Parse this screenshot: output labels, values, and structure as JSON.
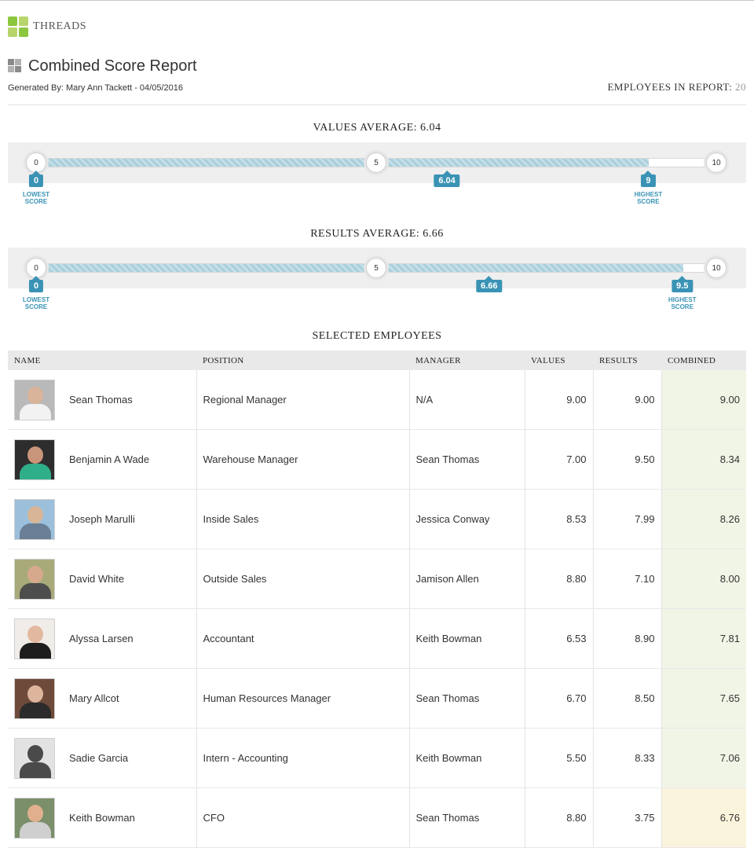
{
  "brand": "THREADS",
  "report": {
    "title": "Combined Score Report",
    "generated": "Generated By: Mary Ann Tackett - 04/05/2016",
    "employees_label": "EMPLOYEES IN REPORT:",
    "employees_count": "20"
  },
  "scales": [
    {
      "title": "VALUES AVERAGE: 6.04",
      "min_label": "0",
      "mid_label": "5",
      "max_label": "10",
      "min": 0,
      "max": 10,
      "lowest": 0,
      "lowest_label": "0",
      "highest": 9,
      "highest_label": "9",
      "average": 6.04,
      "average_label": "6.04",
      "lowest_caption": "LOWEST SCORE",
      "highest_caption": "HIGHEST SCORE"
    },
    {
      "title": "RESULTS AVERAGE: 6.66",
      "min_label": "0",
      "mid_label": "5",
      "max_label": "10",
      "min": 0,
      "max": 10,
      "lowest": 0,
      "lowest_label": "0",
      "highest": 9.5,
      "highest_label": "9.5",
      "average": 6.66,
      "average_label": "6.66",
      "lowest_caption": "LOWEST SCORE",
      "highest_caption": "HIGHEST SCORE"
    }
  ],
  "selected_title": "SELECTED EMPLOYEES",
  "table": {
    "headers": [
      "NAME",
      "POSITION",
      "MANAGER",
      "VALUES",
      "RESULTS",
      "COMBINED"
    ],
    "rows": [
      {
        "name": "Sean Thomas",
        "position": "Regional Manager",
        "manager": "N/A",
        "values": "9.00",
        "results": "9.00",
        "combined": "9.00",
        "avatar_bg": "#b9b9b9",
        "avatar_skin": "#d9b49a",
        "avatar_shirt": "#f2f2f2"
      },
      {
        "name": "Benjamin A Wade",
        "position": "Warehouse Manager",
        "manager": "Sean Thomas",
        "values": "7.00",
        "results": "9.50",
        "combined": "8.34",
        "avatar_bg": "#2d2d2d",
        "avatar_skin": "#c9957a",
        "avatar_shirt": "#2fae8a"
      },
      {
        "name": "Joseph Marulli",
        "position": "Inside Sales",
        "manager": "Jessica Conway",
        "values": "8.53",
        "results": "7.99",
        "combined": "8.26",
        "avatar_bg": "#9cc0dc",
        "avatar_skin": "#d8b596",
        "avatar_shirt": "#6a7f95"
      },
      {
        "name": "David White",
        "position": "Outside Sales",
        "manager": "Jamison Allen",
        "values": "8.80",
        "results": "7.10",
        "combined": "8.00",
        "avatar_bg": "#a8aa7a",
        "avatar_skin": "#d6a98c",
        "avatar_shirt": "#4d4d4d"
      },
      {
        "name": "Alyssa Larsen",
        "position": "Accountant",
        "manager": "Keith Bowman",
        "values": "6.53",
        "results": "8.90",
        "combined": "7.81",
        "avatar_bg": "#f0ece8",
        "avatar_skin": "#e2b9a0",
        "avatar_shirt": "#1e1e1e"
      },
      {
        "name": "Mary Allcot",
        "position": "Human Resources Manager",
        "manager": "Sean Thomas",
        "values": "6.70",
        "results": "8.50",
        "combined": "7.65",
        "avatar_bg": "#6e4a3a",
        "avatar_skin": "#dcb59c",
        "avatar_shirt": "#2b2b2b"
      },
      {
        "name": "Sadie Garcia",
        "position": "Intern - Accounting",
        "manager": "Keith Bowman",
        "values": "5.50",
        "results": "8.33",
        "combined": "7.06",
        "avatar_bg": "#e2e2e2",
        "avatar_skin": "#4a4a4a",
        "avatar_shirt": "#4a4a4a"
      },
      {
        "name": "Keith Bowman",
        "position": "CFO",
        "manager": "Sean Thomas",
        "values": "8.80",
        "results": "3.75",
        "combined": "6.76",
        "avatar_bg": "#7a8f6a",
        "avatar_skin": "#e0b08e",
        "avatar_shirt": "#cfcfcf"
      }
    ]
  }
}
